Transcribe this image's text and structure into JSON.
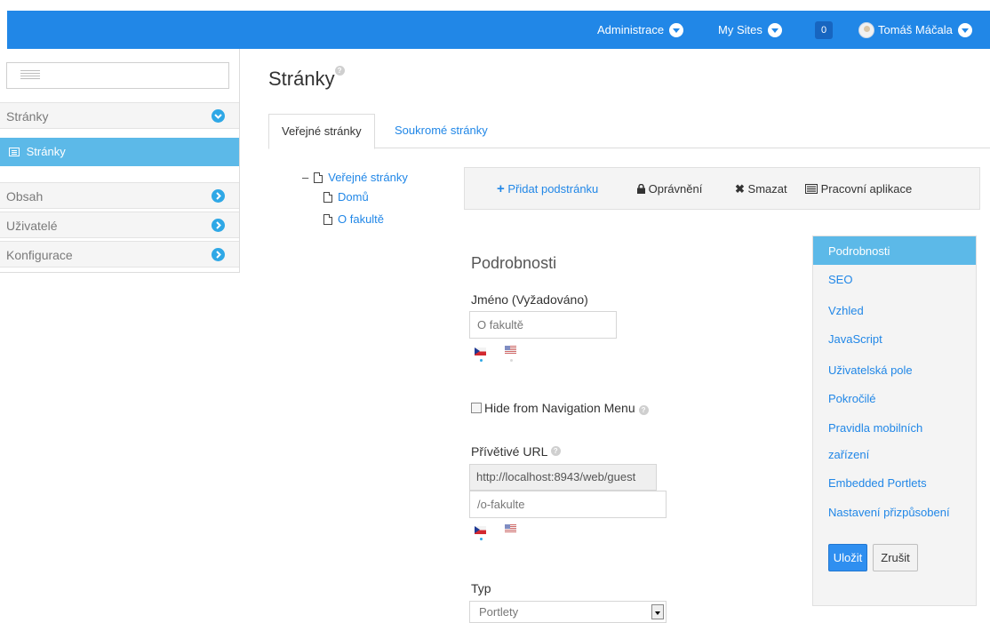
{
  "topbar": {
    "administrace": "Administrace",
    "my_sites": "My Sites",
    "notifications_count": "0",
    "user_name": "Tomáš Máčala",
    "bg_color": "#2187e7"
  },
  "sidebar": {
    "search_placeholder": "",
    "section_label": "Stránky",
    "active_item": "Stránky",
    "items": [
      {
        "label": "Obsah"
      },
      {
        "label": "Uživatelé"
      },
      {
        "label": "Konfigurace"
      }
    ],
    "accent": "#5cb9e8"
  },
  "main": {
    "title": "Stránky",
    "tabs": [
      {
        "label": "Veřejné stránky",
        "active": true
      },
      {
        "label": "Soukromé stránky",
        "active": false
      }
    ],
    "tree": {
      "root": "Veřejné stránky",
      "children": [
        "Domů",
        "O fakultě"
      ]
    },
    "toolbar": {
      "add_child": "Přidat podstránku",
      "permissions": "Oprávnění",
      "delete": "Smazat",
      "work_app": "Pracovní aplikace"
    },
    "form": {
      "section_title": "Podrobnosti",
      "name_label": "Jméno (Vyžadováno)",
      "name_value": "O fakultě",
      "hide_from_nav_label": "Hide from Navigation Menu",
      "hide_from_nav_checked": false,
      "friendly_url_label": "Přívětivé URL",
      "friendly_url_prefix": "http://localhost:8943/web/guest",
      "friendly_url_value": "/o-fakulte",
      "type_label": "Typ",
      "type_value": "Portlety"
    }
  },
  "right_panel": {
    "items": [
      {
        "label": "Podrobnosti",
        "active": true
      },
      {
        "label": "SEO"
      },
      {
        "label": "Vzhled"
      },
      {
        "label": "JavaScript"
      },
      {
        "label": "Uživatelská pole"
      },
      {
        "label": "Pokročilé"
      },
      {
        "label": "Pravidla mobilních"
      },
      {
        "label": "zařízení"
      },
      {
        "label": "Embedded Portlets"
      },
      {
        "label": "Nastavení přizpůsobení"
      }
    ],
    "save_label": "Uložit",
    "cancel_label": "Zrušit"
  }
}
